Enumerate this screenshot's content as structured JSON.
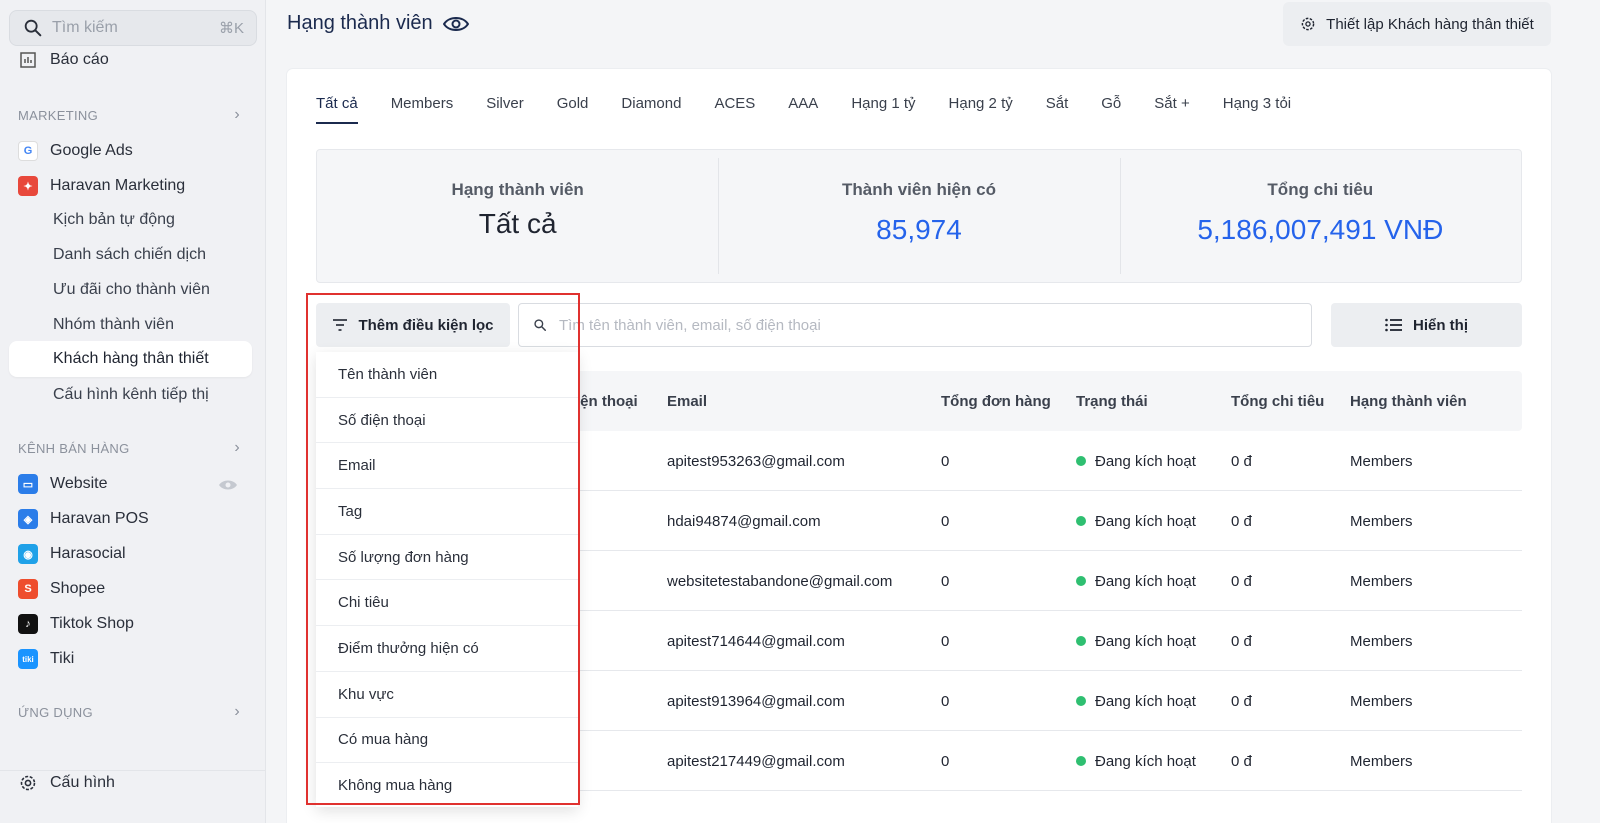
{
  "sidebar": {
    "search_placeholder": "Tìm kiếm",
    "search_shortcut": "⌘K",
    "report_label": "Báo cáo",
    "marketing_section": "MARKETING",
    "google_ads": "Google Ads",
    "haravan_marketing": "Haravan Marketing",
    "marketing_items": [
      "Kịch bản tự động",
      "Danh sách chiến dịch",
      "Ưu đãi cho thành viên",
      "Nhóm thành viên",
      "Khách hàng thân thiết",
      "Cấu hình kênh tiếp thị"
    ],
    "sales_section": "KÊNH BÁN HÀNG",
    "channels": [
      "Website",
      "Haravan POS",
      "Harasocial",
      "Shopee",
      "Tiktok Shop",
      "Tiki"
    ],
    "apps_section": "ỨNG DỤNG",
    "settings_label": "Cấu hình"
  },
  "header": {
    "title": "Hạng thành viên",
    "setup_button": "Thiết lập Khách hàng thân thiết"
  },
  "tabs": [
    "Tất cả",
    "Members",
    "Silver",
    "Gold",
    "Diamond",
    "ACES",
    "AAA",
    "Hạng 1 tỷ",
    "Hạng 2 tỷ",
    "Sắt",
    "Gỗ",
    "Sắt +",
    "Hạng 3 tỏi"
  ],
  "stats": {
    "tier_label": "Hạng thành viên",
    "tier_value": "Tất cả",
    "members_label": "Thành viên hiện có",
    "members_value": "85,974",
    "spend_label": "Tổng chi tiêu",
    "spend_value": "5,186,007,491 VNĐ"
  },
  "toolbar": {
    "filter_button": "Thêm điều kiện lọc",
    "search_placeholder": "Tìm tên thành viên, email, số điện thoại",
    "display_button": "Hiển thị"
  },
  "table": {
    "headers": [
      "iện thoại",
      "Email",
      "Tổng đơn hàng",
      "Trạng thái",
      "Tổng chi tiêu",
      "Hạng thành viên"
    ],
    "rows": [
      {
        "email": "apitest953263@gmail.com",
        "orders": "0",
        "status": "Đang kích hoạt",
        "spend": "0 đ",
        "tier": "Members"
      },
      {
        "email": "hdai94874@gmail.com",
        "orders": "0",
        "status": "Đang kích hoạt",
        "spend": "0 đ",
        "tier": "Members"
      },
      {
        "email": "websitetestabandone@gmail.com",
        "orders": "0",
        "status": "Đang kích hoạt",
        "spend": "0 đ",
        "tier": "Members"
      },
      {
        "email": "apitest714644@gmail.com",
        "orders": "0",
        "status": "Đang kích hoạt",
        "spend": "0 đ",
        "tier": "Members"
      },
      {
        "email": "apitest913964@gmail.com",
        "orders": "0",
        "status": "Đang kích hoạt",
        "spend": "0 đ",
        "tier": "Members"
      },
      {
        "email": "apitest217449@gmail.com",
        "orders": "0",
        "status": "Đang kích hoạt",
        "spend": "0 đ",
        "tier": "Members"
      }
    ]
  },
  "filter_dropdown": [
    "Tên thành viên",
    "Số điện thoại",
    "Email",
    "Tag",
    "Số lượng đơn hàng",
    "Chi tiêu",
    "Điểm thưởng hiện có",
    "Khu vực",
    "Có mua hàng",
    "Không mua hàng"
  ],
  "colors": {
    "accent": "#2563eb",
    "active_status": "#2fbf71",
    "highlight": "#e0312f"
  }
}
